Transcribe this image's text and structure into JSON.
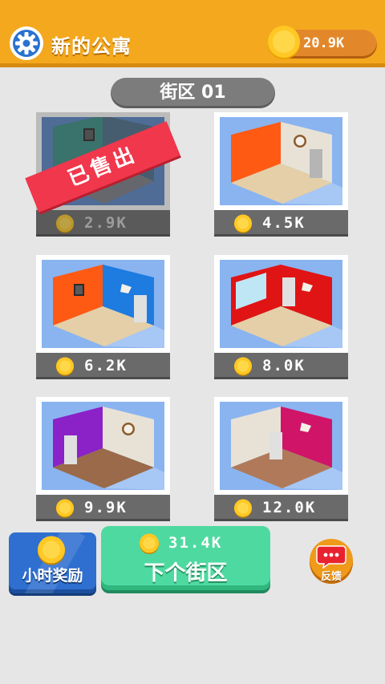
{
  "header": {
    "title": "新的公寓",
    "coins": "20.9K",
    "settings_icon": "gear-icon"
  },
  "district_label": "街区 01",
  "apartments": [
    {
      "price": "2.9K",
      "status": "已售出",
      "wall_left": "#3a8f86",
      "wall_right": "#3a8f86"
    },
    {
      "price": "4.5K",
      "wall_left": "#ff5a14",
      "wall_right": "#e8e2d6"
    },
    {
      "price": "6.2K",
      "wall_left": "#ff5a14",
      "wall_right": "#1e7be0"
    },
    {
      "price": "8.0K",
      "wall_left": "#e01414",
      "wall_right": "#e01414"
    },
    {
      "price": "9.9K",
      "wall_left": "#8a22c8",
      "wall_right": "#e8e2d6"
    },
    {
      "price": "12.0K",
      "wall_left": "#e8e2d6",
      "wall_right": "#d01468"
    }
  ],
  "hourly_reward": {
    "label": "小时奖励"
  },
  "next_district": {
    "price": "31.4K",
    "label": "下个街区"
  },
  "feedback": {
    "label": "反馈"
  },
  "colors": {
    "header": "#f4a81e",
    "coin": "#ffc824",
    "next_button": "#4ed9a0",
    "hourly_button": "#2e6fd0",
    "sold_ribbon": "#f0374c"
  }
}
